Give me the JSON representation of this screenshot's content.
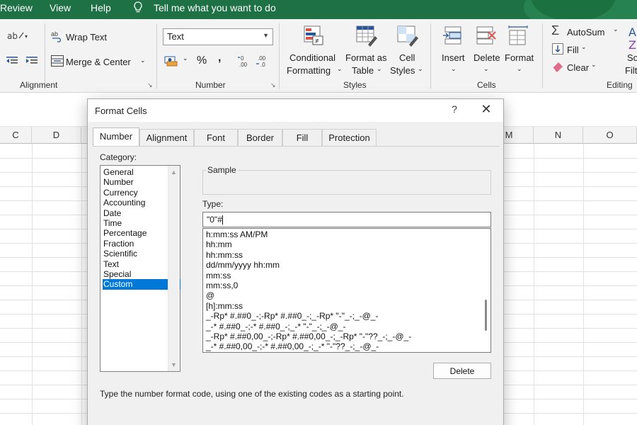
{
  "menubar": {
    "items": [
      "Review",
      "View",
      "Help"
    ],
    "tell_me": "Tell me what you want to do",
    "lightbulb_icon": "lightbulb-icon"
  },
  "ribbon": {
    "alignment": {
      "wrap_text": "Wrap Text",
      "merge_center": "Merge & Center",
      "group_label": "Alignment"
    },
    "number": {
      "format_value": "Text",
      "percent": "%",
      "comma": ",",
      "inc_decimal": ".00",
      "dec_decimal": ".00",
      "group_label": "Number"
    },
    "styles": {
      "conditional_formatting": [
        "Conditional",
        "Formatting"
      ],
      "format_as_table": [
        "Format as",
        "Table"
      ],
      "cell_styles": [
        "Cell",
        "Styles"
      ],
      "group_label": "Styles"
    },
    "cells": {
      "insert": "Insert",
      "delete": "Delete",
      "format": "Format",
      "group_label": "Cells"
    },
    "editing": {
      "autosum": "AutoSum",
      "fill": "Fill",
      "clear": "Clear",
      "sort_partial": "So",
      "find_partial": "Filt",
      "group_label": "Editing"
    }
  },
  "sheet": {
    "columns": [
      "C",
      "D",
      "",
      "M",
      "N",
      "O"
    ]
  },
  "dialog": {
    "title": "Format Cells",
    "help": "?",
    "close": "✕",
    "tabs": [
      "Number",
      "Alignment",
      "Font",
      "Border",
      "Fill",
      "Protection"
    ],
    "active_tab": "Number",
    "category_label": "Category:",
    "categories": [
      "General",
      "Number",
      "Currency",
      "Accounting",
      "Date",
      "Time",
      "Percentage",
      "Fraction",
      "Scientific",
      "Text",
      "Special",
      "Custom"
    ],
    "selected_category": "Custom",
    "sample_label": "Sample",
    "type_label": "Type:",
    "type_value": "\"0\"#",
    "format_codes": [
      "h:mm:ss AM/PM",
      "hh:mm",
      "hh:mm:ss",
      "dd/mm/yyyy hh:mm",
      "mm:ss",
      "mm:ss,0",
      "@",
      "[h]:mm:ss",
      "_-Rp* #.##0_-;-Rp* #.##0_-;_-Rp* \"-\"_-;_-@_-",
      "_-* #.##0_-;-* #.##0_-;_-* \"-\"_-;_-@_-",
      "_-Rp* #.##0,00_-;-Rp* #.##0,00_-;_-Rp* \"-\"??_-;_-@_-",
      "_-* #.##0,00_-;-* #.##0,00_-;_-* \"-\"??_-;_-@_-"
    ],
    "delete_button": "Delete",
    "hint": "Type the number format code, using one of the existing codes as a starting point."
  },
  "colors": {
    "excel_green": "#1e7145",
    "selection_blue": "#0078d7"
  }
}
